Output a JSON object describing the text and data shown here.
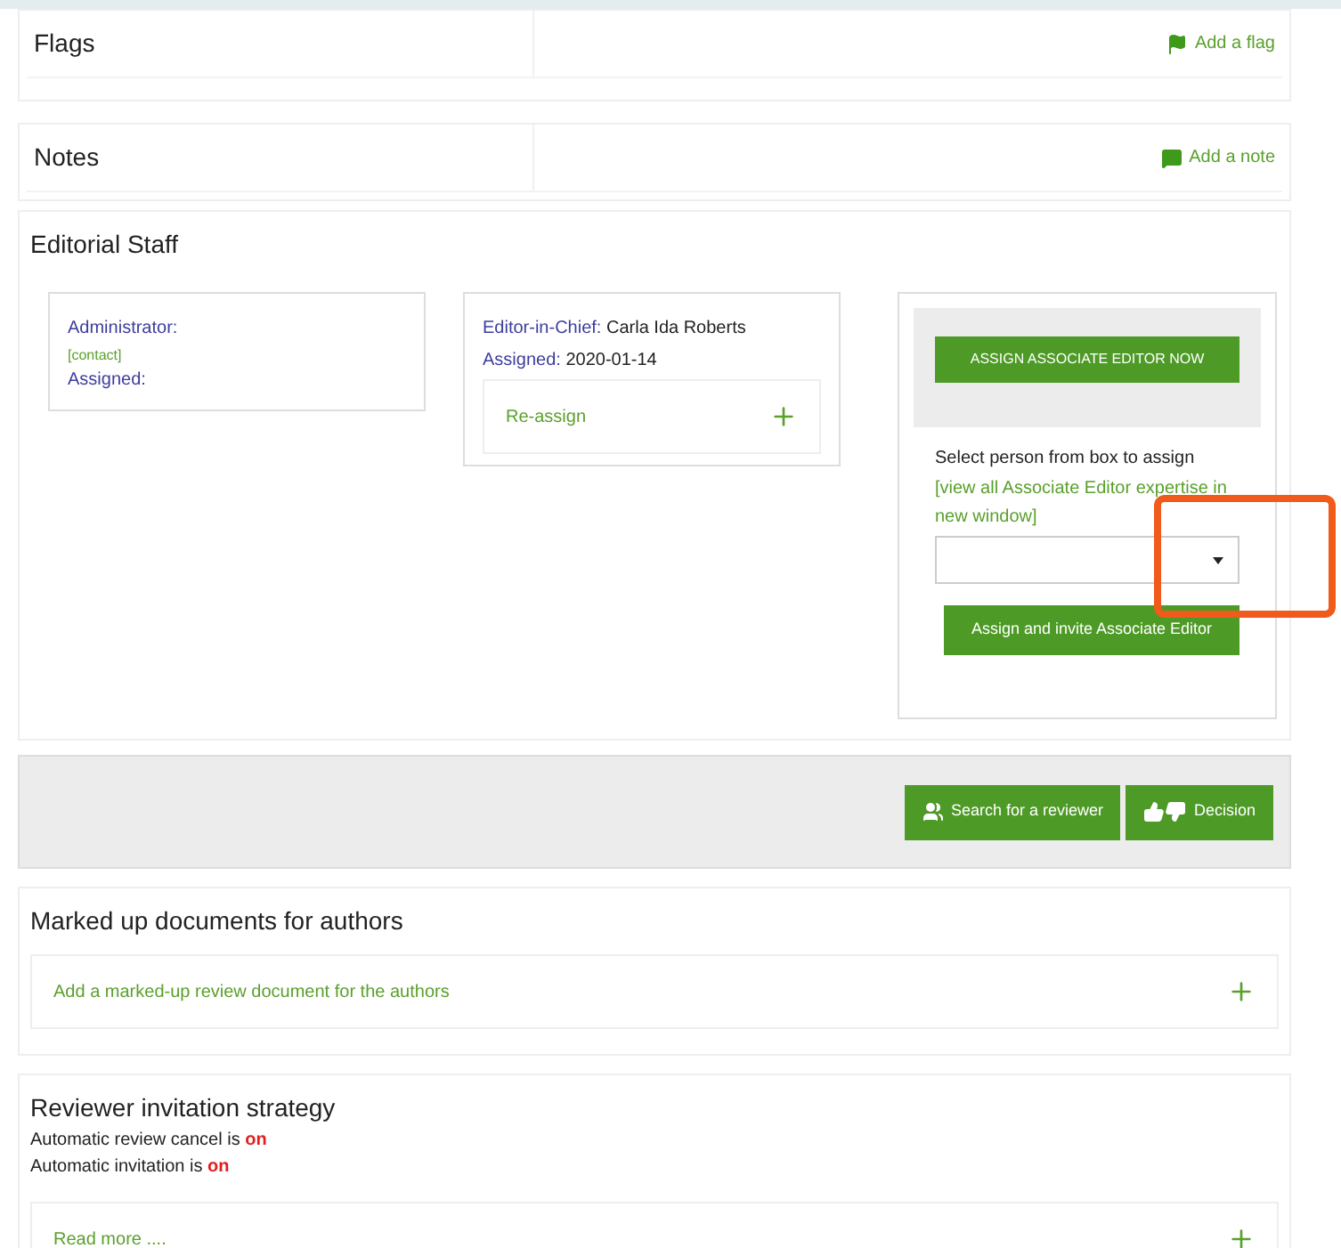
{
  "header_sections": [
    {
      "title": "Flags",
      "action": "Add a flag",
      "kind": "flag"
    },
    {
      "title": "Notes",
      "action": "Add a note",
      "kind": "note"
    }
  ],
  "editorial_staff": {
    "title": "Editorial Staff",
    "administrator": {
      "role": "Administrator:",
      "contact": "[contact]",
      "assigned_label": "Assigned:"
    },
    "editor_in_chief": {
      "role": "Editor-in-Chief:",
      "name": "Carla Ida Roberts",
      "assigned_label": "Assigned:",
      "assigned_date": "2020-01-14",
      "reassign": "Re-assign"
    },
    "associate_editor": {
      "assign_now": "ASSIGN ASSOCIATE EDITOR NOW",
      "instruction": "Select person from box to assign",
      "expertise_link": "[view all Associate Editor expertise in new window]",
      "invite_button": "Assign and invite Associate Editor"
    }
  },
  "action_bar": [
    {
      "label": "Search for a reviewer",
      "kind": "search"
    },
    {
      "label": "Decision",
      "kind": "decision"
    }
  ],
  "marked_up": {
    "title": "Marked up documents for authors",
    "add_link": "Add a marked-up review document for the authors"
  },
  "reviewer_strategy": {
    "title": "Reviewer invitation strategy",
    "settings": [
      {
        "label": "Automatic review cancel is",
        "value": "on"
      },
      {
        "label": "Automatic invitation is",
        "value": "on"
      }
    ],
    "read_more": "Read more ...."
  }
}
